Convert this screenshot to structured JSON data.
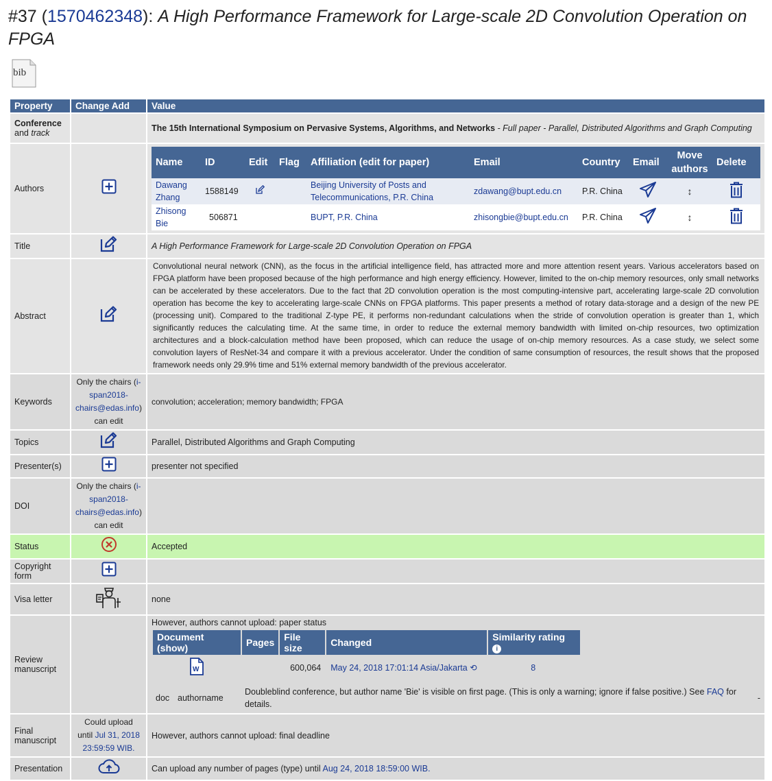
{
  "header": {
    "number": "#37",
    "paper_id": "1570462348",
    "title": "A High Performance Framework for Large-scale 2D Convolution Operation on FPGA"
  },
  "bib_icon": {
    "label": "bib",
    "icon": "bib-file-icon"
  },
  "columns": {
    "property": "Property",
    "change": "Change Add",
    "value": "Value"
  },
  "conference": {
    "label_bold": "Conference",
    "label_rest": "and",
    "label_track": "track",
    "name": "The 15th International Symposium on Pervasive Systems, Algorithms, and Networks",
    "track_text": " - Full paper - Parallel, Distributed Algorithms and Graph Computing"
  },
  "authors": {
    "label": "Authors",
    "headers": {
      "name": "Name",
      "id": "ID",
      "edit": "Edit",
      "flag": "Flag",
      "affiliation": "Affiliation (edit for paper)",
      "email": "Email",
      "country": "Country",
      "email_action": "Email",
      "move": "Move authors",
      "delete": "Delete"
    },
    "rows": [
      {
        "name": "Dawang Zhang",
        "id": "1588149",
        "affiliation": "Beijing University of Posts and Telecommunications, P.R. China",
        "email": "zdawang@bupt.edu.cn",
        "country": "P.R. China",
        "move": "↕"
      },
      {
        "name": "Zhisong Bie",
        "id": "506871",
        "affiliation": "BUPT, P.R. China",
        "email": "zhisongbie@bupt.edu.cn",
        "country": "P.R. China",
        "move": "↕"
      }
    ]
  },
  "title_row": {
    "label": "Title",
    "value": "A High Performance Framework for Large-scale 2D Convolution Operation on FPGA"
  },
  "abstract": {
    "label": "Abstract",
    "text": "Convolutional neural network (CNN), as the focus in the artificial intelligence field, has attracted more and more attention resent years. Various accelerators based on FPGA platform have been proposed because of the high performance and high energy efficiency. However, limited to the on-chip memory resources, only small networks can be accelerated by these accelerators. Due to the fact that 2D convolution operation is the most computing-intensive part, accelerating large-scale 2D convolution operation has become the key to accelerating large-scale CNNs on FPGA platforms. This paper presents a method of rotary data-storage and a design of the new PE (processing unit). Compared to the traditional Z-type PE, it performs non-redundant calculations when the stride of convolution operation is greater than 1, which significantly reduces the calculating time. At the same time, in order to reduce the external memory bandwidth with limited on-chip resources, two optimization architectures and a block-calculation method have been proposed, which can reduce the usage of on-chip memory resources. As a case study, we select some convolution layers of ResNet-34 and compare it with a previous accelerator. Under the condition of same consumption of resources, the result shows that the proposed framework needs only 29.9% time and 51% external memory bandwidth of the previous accelerator."
  },
  "keywords": {
    "label": "Keywords",
    "chairs_prefix": "Only the chairs (",
    "chairs_link": "i-span2018-chairs@edas.info",
    "chairs_suffix": ")",
    "chairs_tail": "can edit",
    "value": "convolution; acceleration; memory bandwidth; FPGA"
  },
  "topics": {
    "label": "Topics",
    "value": "Parallel, Distributed Algorithms and Graph Computing"
  },
  "presenter": {
    "label": "Presenter(s)",
    "value": "presenter not specified"
  },
  "doi": {
    "label": "DOI",
    "chairs_prefix": "Only the chairs (",
    "chairs_link": "i-span2018-chairs@edas.info",
    "chairs_suffix": ")",
    "chairs_tail": "can edit",
    "value": ""
  },
  "status": {
    "label": "Status",
    "value": "Accepted",
    "color": "#c8f5b0"
  },
  "copyright": {
    "label": "Copyright form",
    "value": ""
  },
  "visa": {
    "label": "Visa letter",
    "value": "none"
  },
  "review": {
    "label": "Review manuscript",
    "note": "However, authors cannot upload: paper status",
    "headers": {
      "document": "Document (show)",
      "pages": "Pages",
      "size": "File size",
      "changed": "Changed",
      "similarity": "Similarity rating"
    },
    "row": {
      "pages": "",
      "size": "600,064",
      "changed": "May 24, 2018 17:01:14 Asia/Jakarta",
      "similarity": "8"
    },
    "warning_type": "doc",
    "warning_kind": "authorname",
    "warning_text": "Doubleblind conference, but author name 'Bie' is visible on first page. (This is only a warning; ignore if false positive.) See",
    "faq": "FAQ",
    "warning_tail": "for details.",
    "dash": "-"
  },
  "final": {
    "label": "Final manuscript",
    "could": "Could upload",
    "until": "until",
    "date": "Jul 31, 2018 23:59:59 WIB.",
    "value": "However, authors cannot upload: final deadline"
  },
  "presentation": {
    "label": "Presentation",
    "value_prefix": "Can upload any number of pages (type) until",
    "date": "Aug 24, 2018 18:59:00 WIB."
  },
  "colors": {
    "header_bg": "#456694",
    "link": "#1a3a94",
    "row_bg": "#e4e4e4",
    "status_bg": "#c8f5b0"
  }
}
